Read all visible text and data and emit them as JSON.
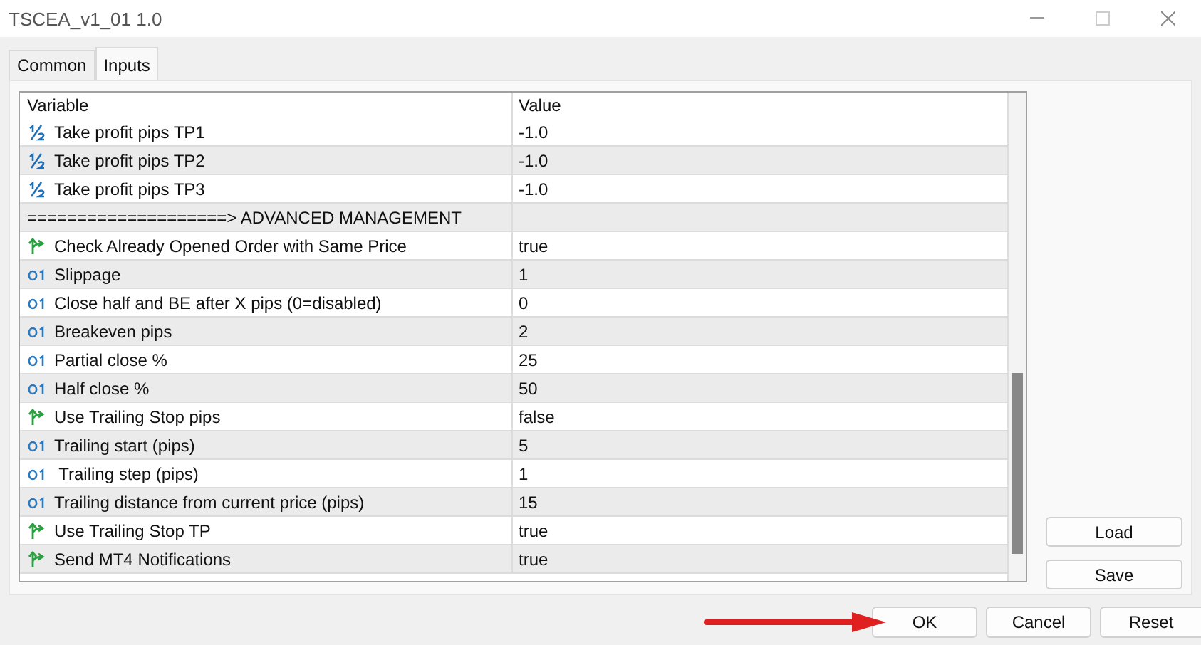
{
  "window": {
    "title": "TSCEA_v1_01 1.0"
  },
  "tabs": [
    {
      "label": "Common",
      "selected": false
    },
    {
      "label": "Inputs",
      "selected": true
    }
  ],
  "table": {
    "columns": [
      "Variable",
      "Value"
    ],
    "rows": [
      {
        "kind": "double",
        "variable": "Take profit pips TP1",
        "value": "-1.0"
      },
      {
        "kind": "double",
        "variable": "Take profit pips TP2",
        "value": "-1.0"
      },
      {
        "kind": "double",
        "variable": "Take profit pips TP3",
        "value": "-1.0"
      },
      {
        "kind": "separator",
        "variable": "====================> ADVANCED MANAGEMENT"
      },
      {
        "kind": "bool",
        "variable": "Check Already Opened Order with Same Price",
        "value": "true"
      },
      {
        "kind": "int",
        "variable": "Slippage",
        "value": "1"
      },
      {
        "kind": "int",
        "variable": "Close half and BE after X pips (0=disabled)",
        "value": "0"
      },
      {
        "kind": "int",
        "variable": "Breakeven pips",
        "value": "2"
      },
      {
        "kind": "int",
        "variable": "Partial close %",
        "value": "25"
      },
      {
        "kind": "int",
        "variable": "Half close %",
        "value": "50"
      },
      {
        "kind": "bool",
        "variable": "Use Trailing Stop pips",
        "value": "false"
      },
      {
        "kind": "int",
        "variable": "Trailing start (pips)",
        "value": "5"
      },
      {
        "kind": "int",
        "variable": " Trailing step (pips)",
        "value": "1"
      },
      {
        "kind": "int",
        "variable": "Trailing distance from current price (pips)",
        "value": "15"
      },
      {
        "kind": "bool",
        "variable": "Use Trailing Stop TP",
        "value": "true"
      },
      {
        "kind": "bool",
        "variable": "Send MT4 Notifications",
        "value": "true"
      }
    ]
  },
  "side_buttons": [
    "Load",
    "Save"
  ],
  "buttons": [
    "OK",
    "Cancel",
    "Reset"
  ]
}
